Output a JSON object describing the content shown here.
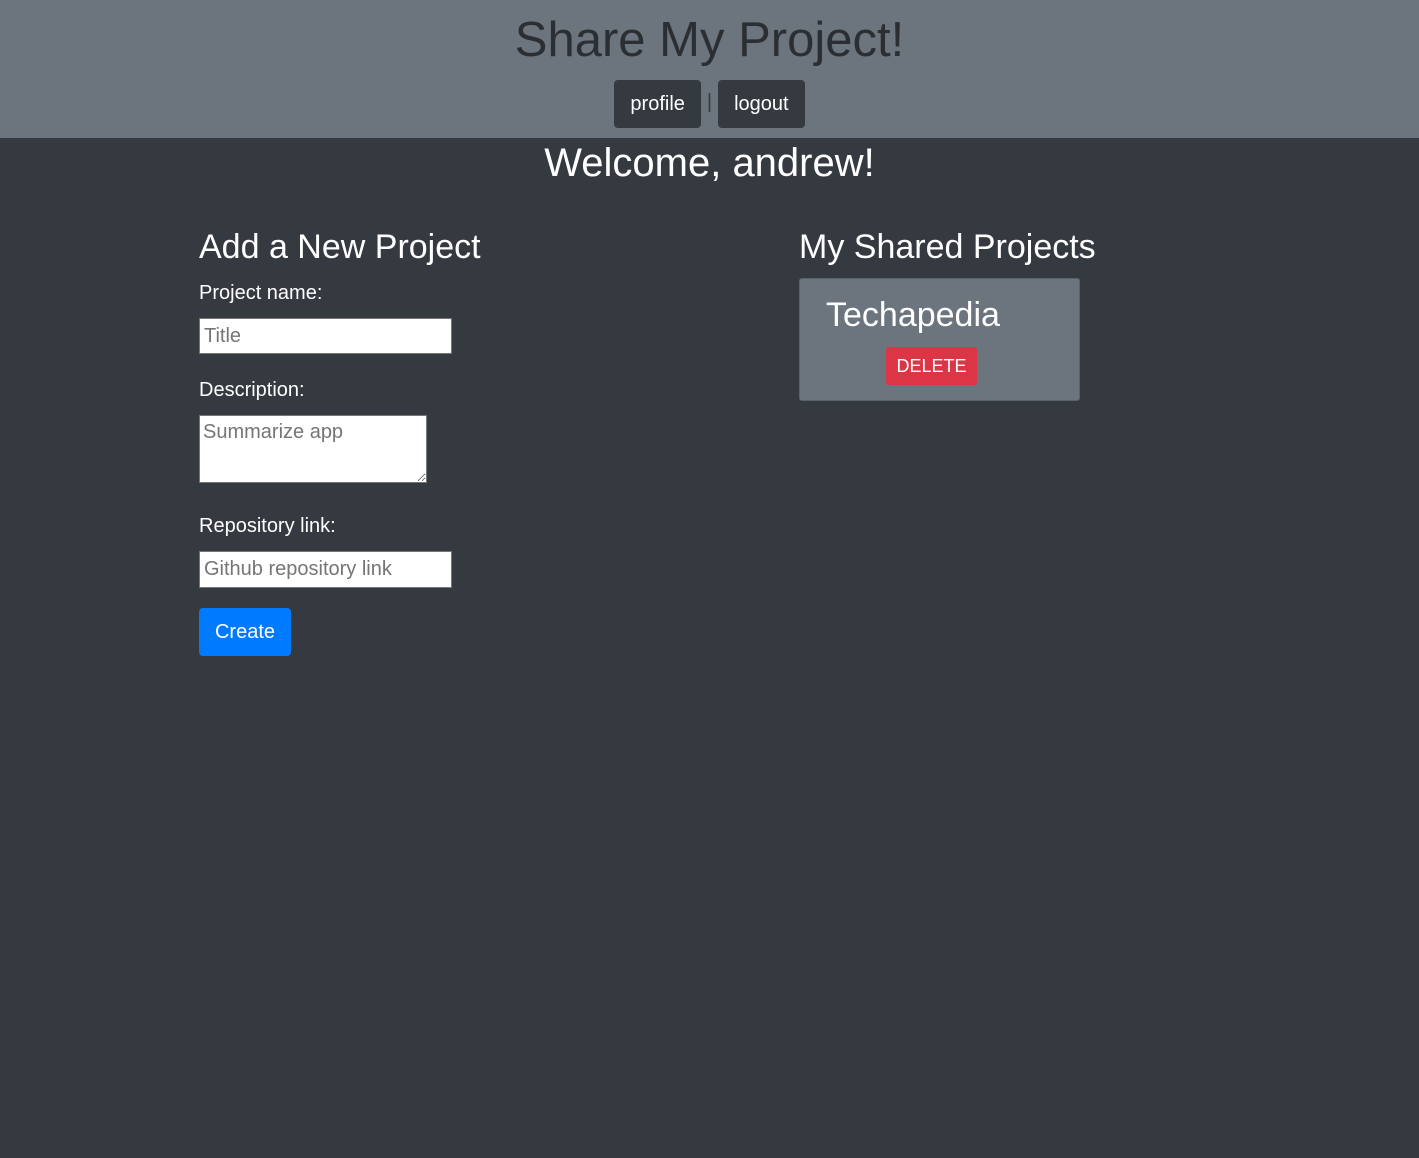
{
  "header": {
    "title": "Share My Project!",
    "nav": {
      "profile_label": "profile",
      "separator": "|",
      "logout_label": "logout"
    }
  },
  "welcome": {
    "text": "Welcome, andrew!"
  },
  "new_project": {
    "heading": "Add a New Project",
    "name_label": "Project name:",
    "name_placeholder": "Title",
    "name_value": "",
    "description_label": "Description:",
    "description_placeholder": "Summarize app",
    "description_value": "",
    "repo_label": "Repository link:",
    "repo_placeholder": "Github repository link",
    "repo_value": "",
    "create_label": "Create"
  },
  "shared_projects": {
    "heading": "My Shared Projects",
    "items": [
      {
        "name": "Techapedia",
        "delete_label": "DELETE"
      }
    ]
  },
  "colors": {
    "header_bg": "#6c757d",
    "page_bg": "#343a40",
    "primary": "#007bff",
    "danger": "#dc3545"
  }
}
